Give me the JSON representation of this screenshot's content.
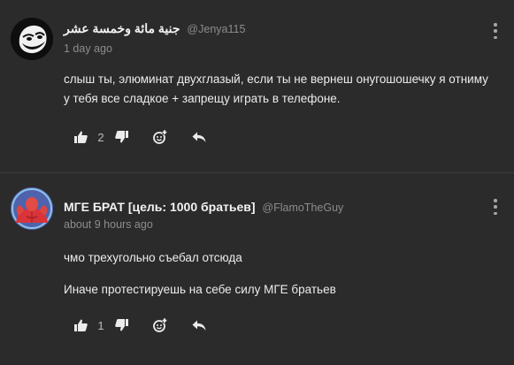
{
  "comments": [
    {
      "author": "جنية مائة وخمسة عشر",
      "handle": "@Jenya115",
      "time": "1 day ago",
      "body": [
        "слыш ты, элюминат двухглазый, если ты не вернеш онугошошечку я отниму у тебя все сладкое + запрещу играть в телефоне."
      ],
      "likes": "2"
    },
    {
      "author": "МГЕ БРАТ [цель: 1000 братьев]",
      "handle": "@FlamoTheGuy",
      "time": "about 9 hours ago",
      "body": [
        "чмо трехугольно съебал отсюда",
        "Иначе протестируешь на себе силу МГЕ братьев"
      ],
      "likes": "1"
    }
  ],
  "icons": {
    "like": "thumbs-up-icon",
    "dislike": "thumbs-down-icon",
    "react": "add-reaction-icon",
    "reply": "reply-icon",
    "menu": "more-vertical-icon"
  },
  "colors": {
    "background": "#2b2b2b",
    "text": "#e6e6e6",
    "muted": "#8c8c8c",
    "divider": "#3d3d3d"
  }
}
